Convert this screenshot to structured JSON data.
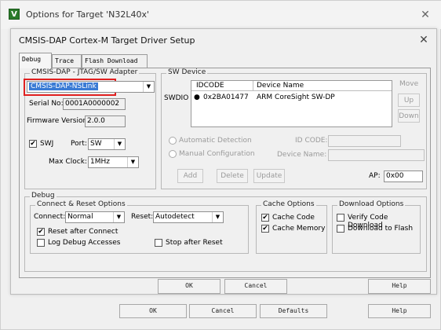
{
  "outer_window": {
    "logo_letter": "V",
    "title": "Options for Target 'N32L40x'",
    "close": "✕",
    "buttons": {
      "ok": "OK",
      "cancel": "Cancel",
      "defaults": "Defaults",
      "help": "Help"
    }
  },
  "dialog": {
    "title": "CMSIS-DAP Cortex-M Target Driver Setup",
    "close": "✕",
    "tabs": [
      {
        "label": "Debug",
        "active": true
      },
      {
        "label": "Trace",
        "active": false
      },
      {
        "label": "Flash Download",
        "active": false
      }
    ],
    "buttons": {
      "ok": "OK",
      "cancel": "Cancel",
      "help": "Help"
    }
  },
  "adapter": {
    "group_label": "CMSIS-DAP - JTAG/SW Adapter",
    "selected": "CMSIS-DAP-NSLink",
    "serial_label": "Serial No:",
    "serial_value": "0001A0000002",
    "firmware_label": "Firmware Version:",
    "firmware_value": "2.0.0",
    "swj_label": "SWJ",
    "swj_checked": true,
    "port_label": "Port:",
    "port_value": "SW",
    "maxclock_label": "Max Clock:",
    "maxclock_value": "1MHz"
  },
  "sw_device": {
    "group_label": "SW Device",
    "swdio_label": "SWDIO",
    "col_idcode": "IDCODE",
    "col_device": "Device Name",
    "rows": [
      {
        "idcode": "0x2BA01477",
        "device": "ARM CoreSight SW-DP"
      }
    ],
    "move_label": "Move",
    "up_button": "Up",
    "down_button": "Down",
    "auto_detect_label": "Automatic Detection",
    "manual_config_label": "Manual Configuration",
    "idcode_field_label": "ID CODE:",
    "device_name_label": "Device Name:",
    "add_button": "Add",
    "delete_button": "Delete",
    "update_button": "Update",
    "ap_label": "AP:",
    "ap_value": "0x00"
  },
  "debug": {
    "group_label": "Debug",
    "connect_reset": {
      "group_label": "Connect & Reset Options",
      "connect_label": "Connect:",
      "connect_value": "Normal",
      "reset_label": "Reset:",
      "reset_value": "Autodetect",
      "reset_after_connect": "Reset after Connect",
      "reset_after_connect_checked": true,
      "log_debug_accesses": "Log Debug Accesses",
      "log_debug_accesses_checked": false,
      "stop_after_reset": "Stop after Reset",
      "stop_after_reset_checked": false
    },
    "cache": {
      "group_label": "Cache Options",
      "cache_code": "Cache Code",
      "cache_code_checked": true,
      "cache_memory": "Cache Memory",
      "cache_memory_checked": true
    },
    "download": {
      "group_label": "Download Options",
      "verify_code": "Verify Code Download",
      "verify_code_checked": false,
      "download_flash": "Download to Flash",
      "download_flash_checked": false
    }
  },
  "icons": {
    "check": "✔",
    "dropdown": "▼",
    "radio_dot": "●"
  },
  "colors": {
    "highlight_box": "#e02020",
    "selection": "#3a7bd5"
  }
}
